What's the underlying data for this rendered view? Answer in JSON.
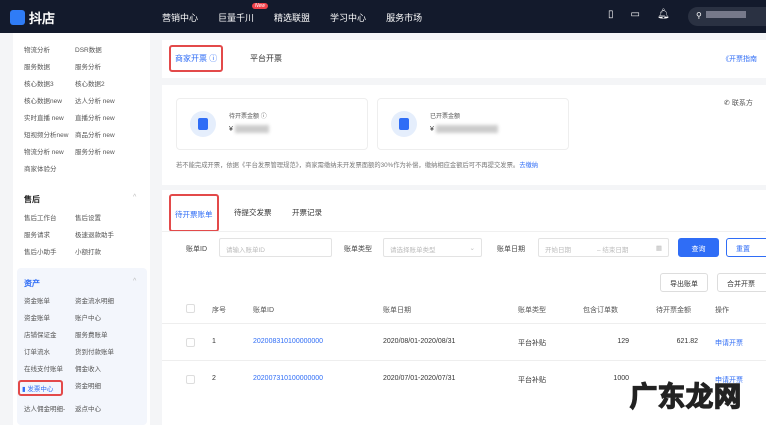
{
  "topbar": {
    "logo": "抖店",
    "nav": [
      "营销中心",
      "巨量千川",
      "精选联盟",
      "学习中心",
      "服务市场"
    ],
    "new_badge": "New",
    "icons": [
      "phone-icon",
      "message-icon",
      "bell-icon"
    ]
  },
  "sidebar": {
    "data_items": [
      "物流分析",
      "DSR数据",
      "服务数据",
      "服务分析",
      "核心数据3",
      "核心数据2",
      "核心数据new",
      "达人分析 new",
      "实时直播 new",
      "直播分析 new",
      "短视频分析new",
      "商品分析 new",
      "物流分析 new",
      "服务分析 new",
      "商家体验分"
    ],
    "after_sale": {
      "title": "售后",
      "items": [
        "售后工作台",
        "售后设置",
        "服务请求",
        "极速退款助手",
        "售后小助手",
        "小额打款"
      ]
    },
    "assets": {
      "title": "资产",
      "items": [
        "资金账单",
        "资金流水明细",
        "资金账单",
        "账户中心",
        "店铺保证金",
        "服务费账单",
        "订单流水",
        "货到付款账单",
        "在线支付账单",
        "佣金收入",
        "发票中心",
        "资金明细",
        "达人佣金明细-",
        "返点中心"
      ]
    }
  },
  "main": {
    "top_tabs": [
      "商家开票",
      "平台开票"
    ],
    "guide_link": "《开票指南",
    "pending_amount_label": "待开票金额",
    "issued_amount_label": "已开票金额",
    "currency": "¥",
    "contact": "联系方",
    "notice": "若不能完成开票，依据《平台发票管理规范》，商家需缴纳未开发票面额的30%作为补偿，缴纳相应金额后可不再提交发票。",
    "notice_link": "去缴纳",
    "sub_tabs": [
      "待开票账单",
      "待提交发票",
      "开票记录"
    ],
    "filters": {
      "bill_id_label": "账单ID",
      "bill_id_placeholder": "请输入账单ID",
      "bill_type_label": "账单类型",
      "bill_type_placeholder": "请选择账单类型",
      "bill_date_label": "账单日期",
      "start_placeholder": "开始日期",
      "end_placeholder": "结束日期",
      "query": "查询",
      "reset": "重置"
    },
    "actions": {
      "export": "导出账单",
      "merge": "合并开票"
    },
    "table": {
      "headers": [
        "序号",
        "账单ID",
        "账单日期",
        "账单类型",
        "包含订单数",
        "待开票金额",
        "操作"
      ],
      "rows": [
        {
          "no": "1",
          "id": "202008310100000000",
          "date": "2020/08/01-2020/08/31",
          "type": "平台补贴",
          "orders": "129",
          "amount": "621.82",
          "op": "申请开票"
        },
        {
          "no": "2",
          "id": "202007310100000000",
          "date": "2020/07/01-2020/07/31",
          "type": "平台补贴",
          "orders": "1000",
          "amount": "",
          "op": "申请开票"
        }
      ]
    }
  },
  "watermark": "广东龙网"
}
